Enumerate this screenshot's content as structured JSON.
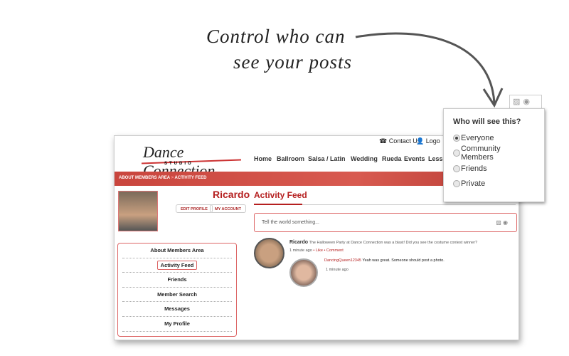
{
  "callout": {
    "line1": "Control who can",
    "line2": "see your posts"
  },
  "site": {
    "logo_text": "Dance Connection",
    "logo_sub": "STUDIO",
    "contact": "Contact Us",
    "logout": "Logo",
    "nav": [
      "Home",
      "Ballroom",
      "Salsa / Latin",
      "Wedding",
      "Rueda",
      "Events",
      "Less"
    ],
    "breadcrumb": [
      "ABOUT MEMBERS AREA",
      ">",
      "ACTIVITY FEED"
    ]
  },
  "profile": {
    "name": "Ricardo",
    "edit": "EDIT PROFILE",
    "account": "MY ACCOUNT"
  },
  "sidebar": {
    "items": [
      "About Members Area",
      "Activity Feed",
      "Friends",
      "Member Search",
      "Messages",
      "My Profile"
    ],
    "active": "Activity Feed"
  },
  "feed": {
    "title": "Activity Feed",
    "placeholder": "Tell the world something...",
    "post": {
      "author": "Ricardo",
      "text": "The Halloween Party at Dance Connection was a blast! Did you see the costume contest winner?",
      "time": "1 minute ago",
      "sep": "•",
      "like": "Like",
      "comment": "Comment"
    },
    "reply": {
      "author": "DancingQueen12345",
      "text": "Yeah was great. Someone should post a photo.",
      "time": "1 minute ago"
    }
  },
  "privacy": {
    "title": "Who will see this?",
    "options": [
      "Everyone",
      "Community Members",
      "Friends",
      "Private"
    ],
    "selected": "Everyone"
  },
  "colors": {
    "accent": "#b51f1f",
    "banner": "#c9453d"
  },
  "icons": [
    "image-icon",
    "eye-icon",
    "phone-icon",
    "user-icon"
  ]
}
